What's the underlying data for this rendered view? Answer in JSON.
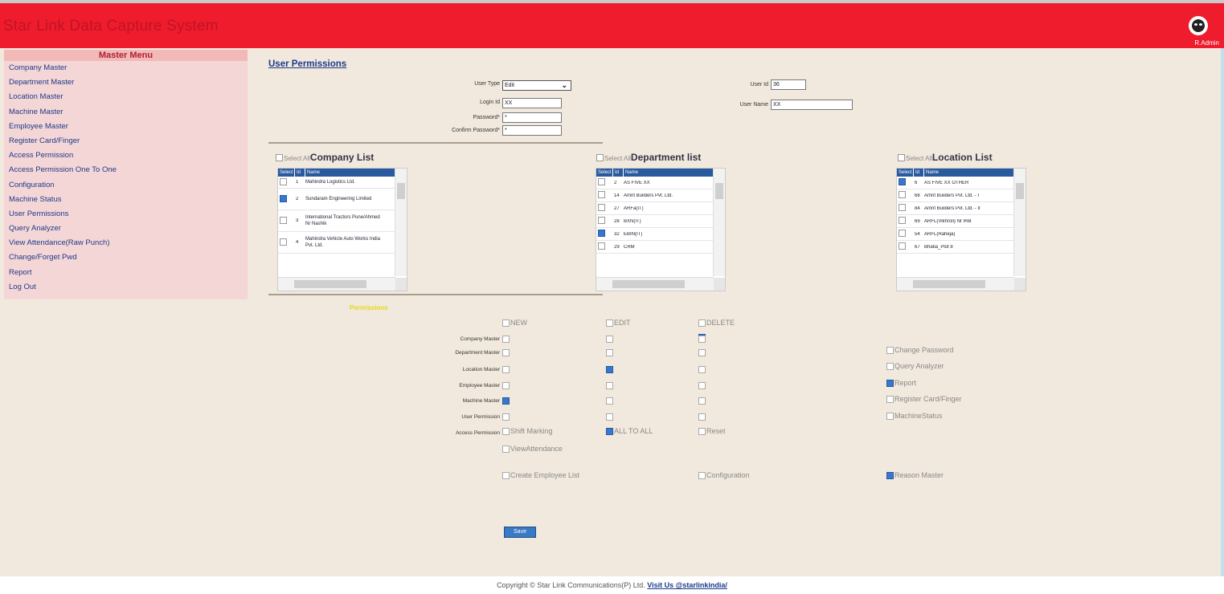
{
  "app": {
    "title": "Star Link Data Capture System",
    "user_name": "R.Admin"
  },
  "sidebar": {
    "title": "Master Menu",
    "items": [
      {
        "label": "Company Master"
      },
      {
        "label": "Department Master"
      },
      {
        "label": "Location Master"
      },
      {
        "label": "Machine Master"
      },
      {
        "label": "Employee Master"
      },
      {
        "label": "Register Card/Finger"
      },
      {
        "label": "Access Permission"
      },
      {
        "label": "Access Permission One To One"
      },
      {
        "label": "Configuration"
      },
      {
        "label": "Machine Status"
      },
      {
        "label": "User Permissions"
      },
      {
        "label": "Query Analyzer"
      },
      {
        "label": "View Attendance(Raw Punch)"
      },
      {
        "label": "Change/Forget Pwd"
      },
      {
        "label": "Report"
      },
      {
        "label": "Log Out"
      }
    ]
  },
  "form": {
    "page_title": "User Permissions",
    "user_type_label": "User Type",
    "user_type_value": "Edit",
    "login_id_label": "Login Id",
    "login_id_value": "XX",
    "password_label": "Password*",
    "password_value": "*",
    "confirm_password_label": "Confirm Password*",
    "confirm_password_value": "*",
    "user_id_label": "User Id",
    "user_id_value": "36",
    "user_name_label": "User Name",
    "user_name_value": "XX"
  },
  "lists": {
    "select_all": "Select All",
    "company": {
      "title": "Company List",
      "headers": [
        "Select",
        "Id",
        "Name"
      ],
      "rows": [
        {
          "checked": false,
          "id": "1",
          "name": "Mahindra Logistics Ltd."
        },
        {
          "checked": true,
          "id": "2",
          "name": "Sundaram Engineering Limited"
        },
        {
          "checked": false,
          "id": "3",
          "name": "International Tractors Pune/Ahmed Nr Nashik"
        },
        {
          "checked": false,
          "id": "4",
          "name": "Mahindra Vehicle Auto Works India Pvt. Ltd."
        }
      ]
    },
    "department": {
      "title": "Department list",
      "headers": [
        "Select",
        "Id",
        "Name"
      ],
      "rows": [
        {
          "checked": false,
          "id": "2",
          "name": "AS FIVE XX"
        },
        {
          "checked": false,
          "id": "14",
          "name": "Amrit Builders Pvt. Ltd."
        },
        {
          "checked": false,
          "id": "27",
          "name": "ARFa(IT)"
        },
        {
          "checked": false,
          "id": "28",
          "name": "BXN(IT)"
        },
        {
          "checked": true,
          "id": "32",
          "name": "EBIN(IT)"
        },
        {
          "checked": false,
          "id": "29",
          "name": "CRM"
        }
      ]
    },
    "location": {
      "title": "Location List",
      "headers": [
        "Select",
        "Id",
        "Name"
      ],
      "rows": [
        {
          "checked": true,
          "id": "6",
          "name": "AS FIVE XX OTHER"
        },
        {
          "checked": false,
          "id": "68",
          "name": "Amrit Builders Pvt. Ltd. - I"
        },
        {
          "checked": false,
          "id": "84",
          "name": "Amrit Builders Pvt. Ltd. - II"
        },
        {
          "checked": false,
          "id": "69",
          "name": "ARFL(Vikhroli) Nr IRB"
        },
        {
          "checked": false,
          "id": "54",
          "name": "ARFL(Raheja)"
        },
        {
          "checked": false,
          "id": "67",
          "name": "Bhatia_Plot 8"
        }
      ]
    }
  },
  "permissions": {
    "label": "Permissions",
    "columns": [
      "NEW",
      "EDIT",
      "DELETE"
    ],
    "rows": [
      {
        "label": "Company Master",
        "new": false,
        "edit": false,
        "delete": false
      },
      {
        "label": "Department Master",
        "new": false,
        "edit": false,
        "delete": false
      },
      {
        "label": "Location Master",
        "new": false,
        "edit": true,
        "delete": false
      },
      {
        "label": "Employee Master",
        "new": false,
        "edit": false,
        "delete": false
      },
      {
        "label": "Machine Master",
        "new": true,
        "edit": false,
        "delete": false
      },
      {
        "label": "User Permission",
        "new": false,
        "edit": false,
        "delete": false
      }
    ],
    "delete_header_checked": true,
    "access_permission_label": "Access Permission",
    "shift_marking": {
      "label": "Shift Marking",
      "checked": false
    },
    "all_to_all": {
      "label": "ALL TO ALL",
      "checked": true
    },
    "reset": {
      "label": "Reset",
      "checked": false
    },
    "view_attendance": {
      "label": "ViewAttendance",
      "checked": false
    },
    "create_employee_list": {
      "label": "Create Employee List",
      "checked": false
    },
    "configuration": {
      "label": "Configuration",
      "checked": false
    },
    "reason_master": {
      "label": "Reason Master",
      "checked": true
    },
    "right_options": [
      {
        "label": "Change Password",
        "checked": false
      },
      {
        "label": "Query Analyzer",
        "checked": false
      },
      {
        "label": "Report",
        "checked": true
      },
      {
        "label": "Register Card/Finger",
        "checked": false
      },
      {
        "label": "MachineStatus",
        "checked": false
      }
    ]
  },
  "save_label": "Save",
  "footer": {
    "text": "Copyright © Star Link Communications(P) Ltd.",
    "link": "Visit Us @starlinkindia/"
  }
}
